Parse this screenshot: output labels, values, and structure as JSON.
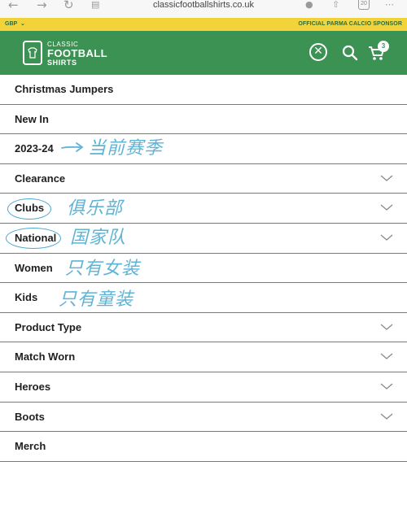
{
  "browser": {
    "url": "classicfootballshirts.co.uk",
    "tab_count": "20",
    "back_icon": "arrow-left-icon",
    "forward_icon": "arrow-right-icon",
    "reload_icon": "reload-icon",
    "reader_icon": "reader-icon",
    "mic_icon": "microphone-icon",
    "share_icon": "share-icon",
    "more_icon": "more-icon"
  },
  "promo": {
    "currency": "GBP",
    "sponsor": "OFFICIAL PARMA CALCIO SPONSOR"
  },
  "header": {
    "logo_line1": "CLASSIC",
    "logo_line2": "FOOTBALL",
    "logo_line3": "SHIRTS",
    "cart_count": "3",
    "brand_color": "#3c9253",
    "promo_color": "#f2d43a"
  },
  "menu": {
    "items": [
      {
        "label": "Christmas Jumpers",
        "has_submenu": false
      },
      {
        "label": "New In",
        "has_submenu": false
      },
      {
        "label": "2023-24",
        "has_submenu": false
      },
      {
        "label": "Clearance",
        "has_submenu": true
      },
      {
        "label": "Clubs",
        "has_submenu": true
      },
      {
        "label": "National",
        "has_submenu": true
      },
      {
        "label": "Women",
        "has_submenu": false
      },
      {
        "label": "Kids",
        "has_submenu": false
      },
      {
        "label": "Product Type",
        "has_submenu": true
      },
      {
        "label": "Match Worn",
        "has_submenu": true
      },
      {
        "label": "Heroes",
        "has_submenu": true
      },
      {
        "label": "Boots",
        "has_submenu": true
      },
      {
        "label": "Merch",
        "has_submenu": false
      }
    ]
  },
  "annotations": {
    "season_note": "当前赛季",
    "clubs_note": "俱乐部",
    "national_note": "国家队",
    "women_note": "只有女装",
    "kids_note": "只有童装",
    "ink_color": "#5fb4d6"
  }
}
